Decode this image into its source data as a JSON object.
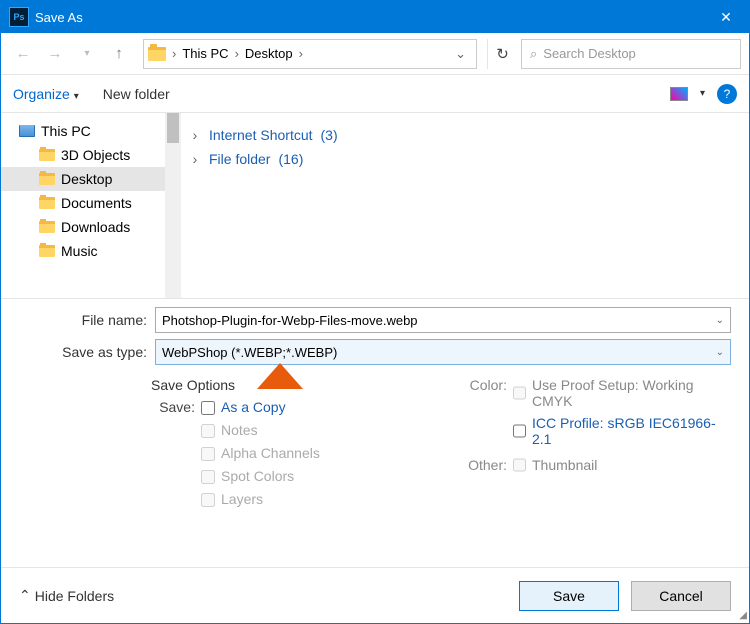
{
  "titlebar": {
    "app": "Ps",
    "title": "Save As"
  },
  "nav": {
    "breadcrumbs": [
      "This PC",
      "Desktop"
    ],
    "search_placeholder": "Search Desktop"
  },
  "cmdbar": {
    "organize": "Organize",
    "newfolder": "New folder",
    "help": "?"
  },
  "tree": {
    "root": "This PC",
    "items": [
      "3D Objects",
      "Desktop",
      "Documents",
      "Downloads",
      "Music"
    ],
    "selected_index": 1
  },
  "files": [
    {
      "name": "Internet Shortcut",
      "count": "(3)"
    },
    {
      "name": "File folder",
      "count": "(16)"
    }
  ],
  "form": {
    "filename_label": "File name:",
    "filename_value": "Photshop-Plugin-for-Webp-Files-move.webp",
    "type_label": "Save as type:",
    "type_value": "WebPShop (*.WEBP;*.WEBP)"
  },
  "saveopts": {
    "header": "Save Options",
    "save_label": "Save:",
    "as_copy": "As a Copy",
    "notes": "Notes",
    "alpha": "Alpha Channels",
    "spot": "Spot Colors",
    "layers": "Layers",
    "color_label": "Color:",
    "proof": "Use Proof Setup: Working CMYK",
    "icc": "ICC Profile:  sRGB IEC61966-2.1",
    "other_label": "Other:",
    "thumb": "Thumbnail"
  },
  "footer": {
    "hide": "Hide Folders",
    "save": "Save",
    "cancel": "Cancel"
  }
}
